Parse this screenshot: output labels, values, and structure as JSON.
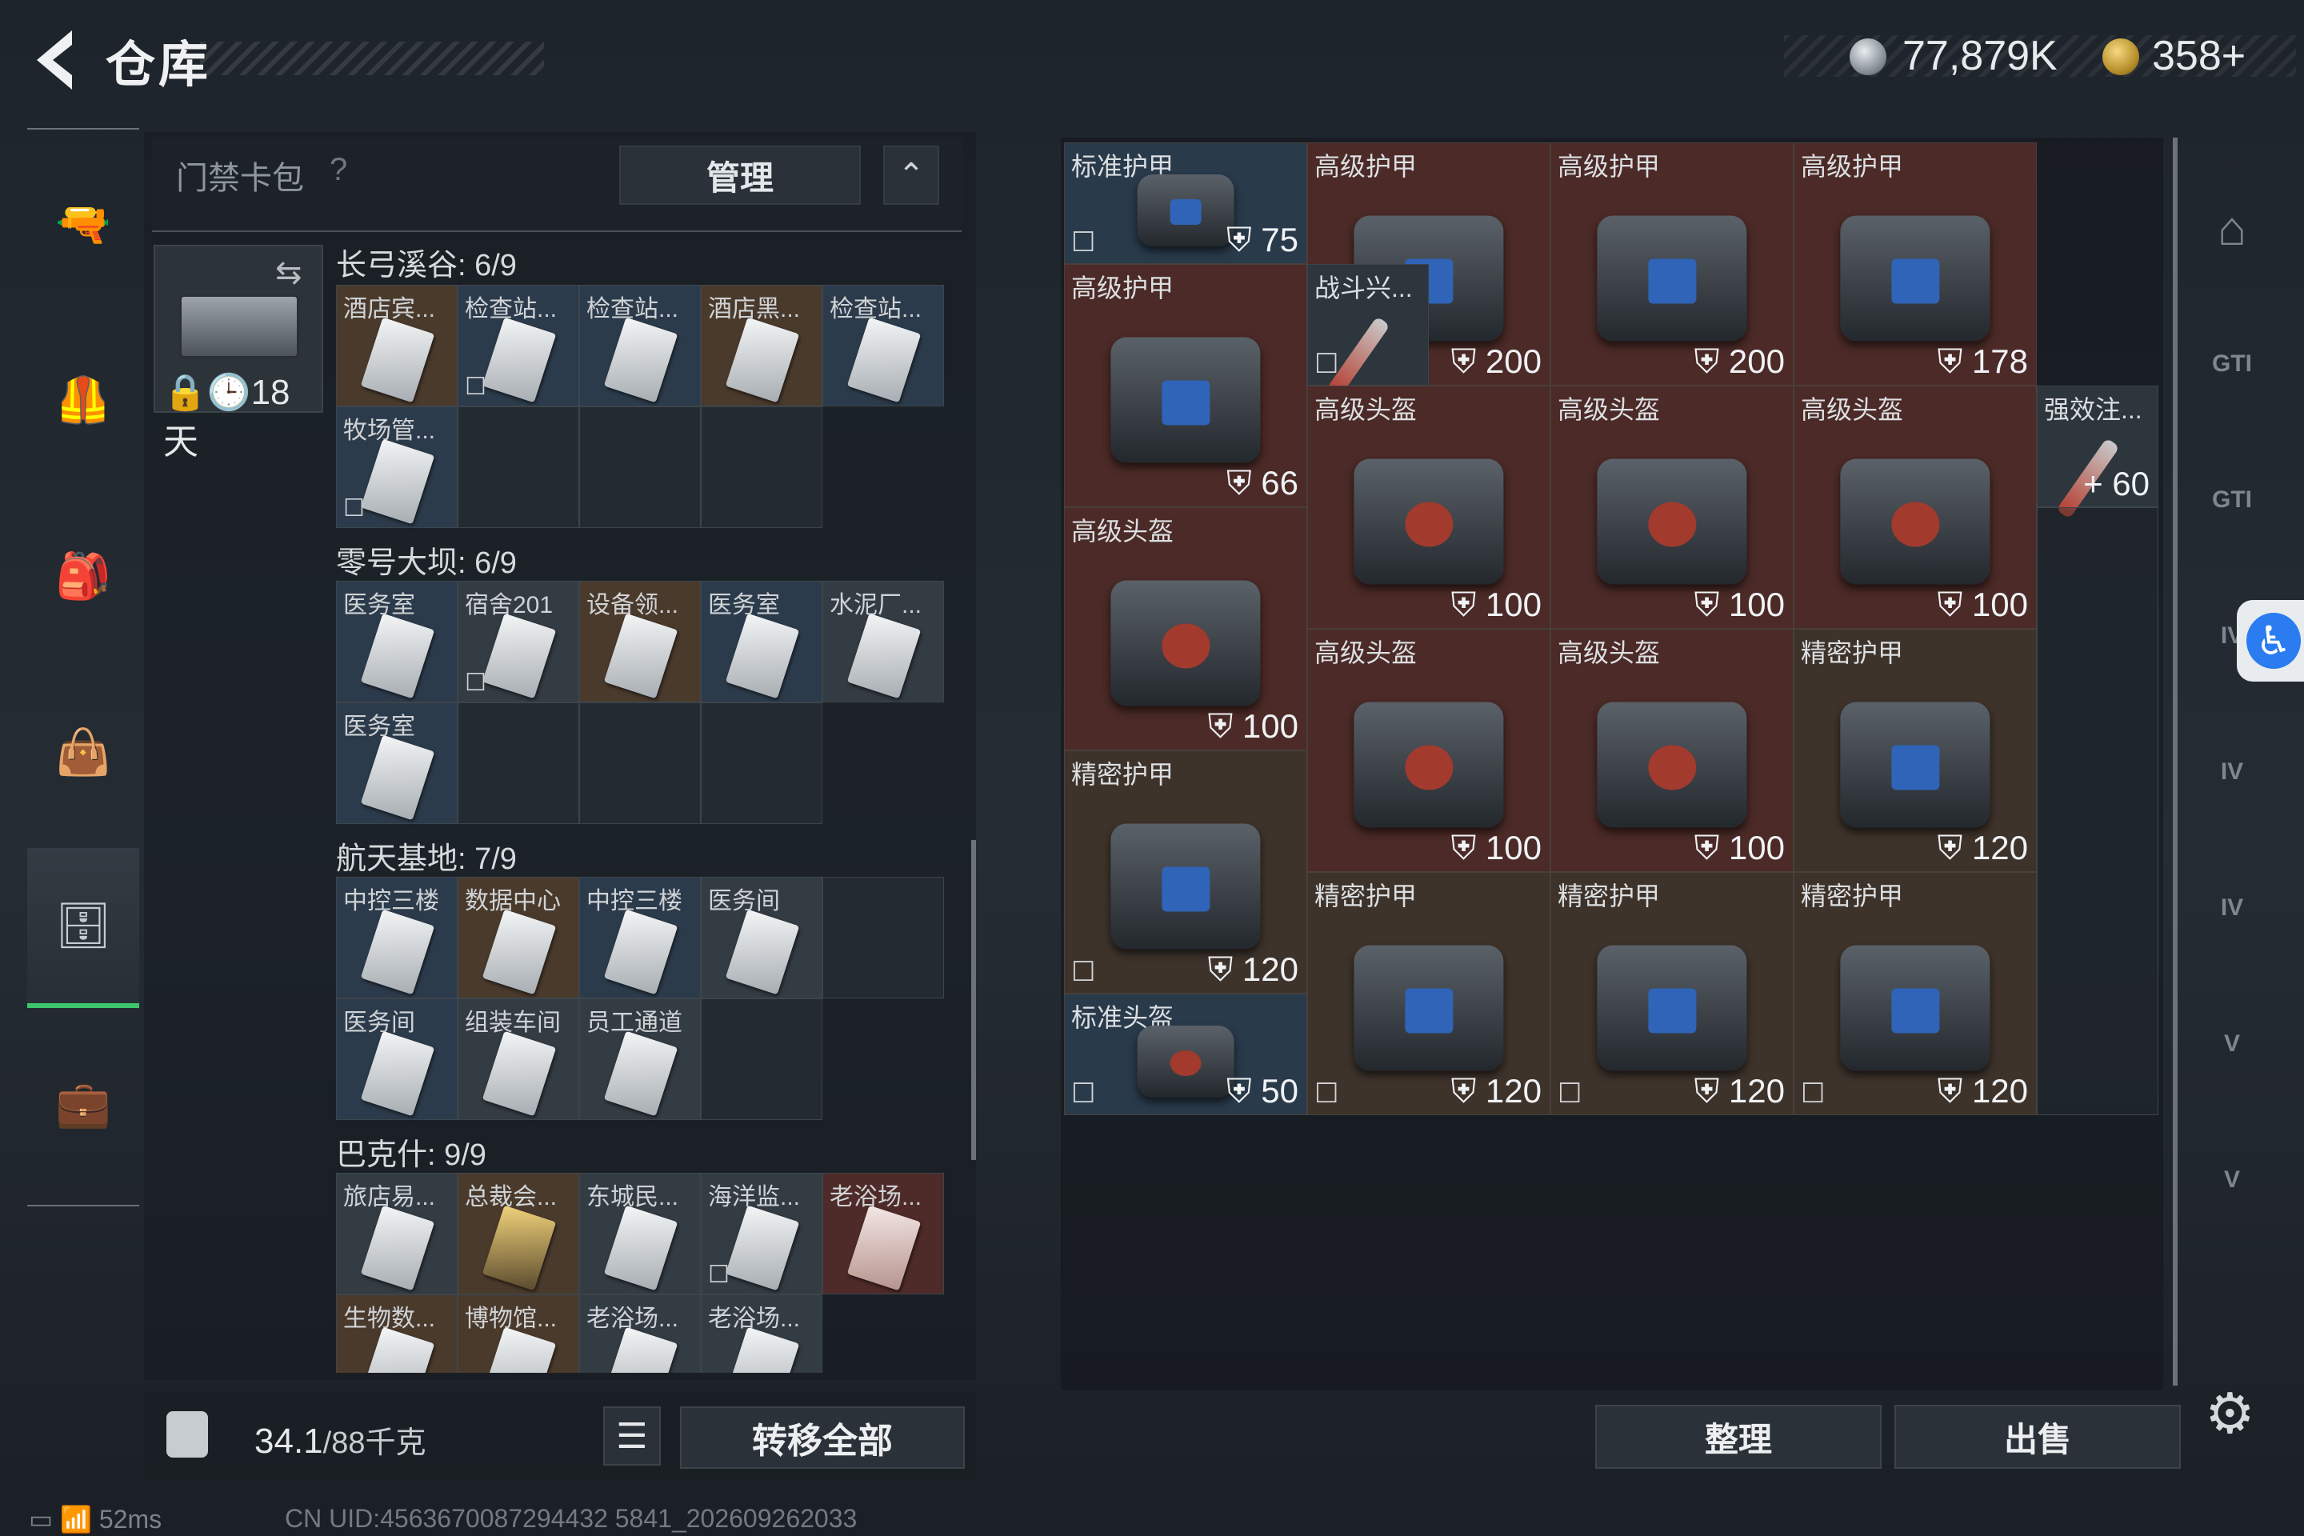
{
  "header": {
    "title": "仓库",
    "currency_silver": "77,879K",
    "currency_gold": "358+"
  },
  "card_pack": {
    "title": "门禁卡包",
    "help": "?",
    "manage_label": "管理",
    "collapse_icon": "chevron-up-icon",
    "days": "18天"
  },
  "sections": [
    {
      "title": "长弓溪谷: 6/9",
      "cards": [
        "酒店宾...",
        "检查站...",
        "检查站...",
        "酒店黑...",
        "检查站...",
        "牧场管..."
      ]
    },
    {
      "title": "零号大坝: 6/9",
      "cards": [
        "医务室",
        "宿舍201",
        "设备领...",
        "医务室",
        "水泥厂...",
        "医务室"
      ]
    },
    {
      "title": "航天基地: 7/9",
      "cards": [
        "中控三楼",
        "数据中心",
        "中控三楼",
        "医务间",
        "医务间",
        "组装车间",
        "员工通道"
      ]
    },
    {
      "title": "巴克什: 9/9",
      "cards": [
        "旅店易...",
        "总裁会...",
        "东城民...",
        "海洋监...",
        "老浴场...",
        "生物数...",
        "博物馆...",
        "老浴场...",
        "老浴场..."
      ]
    }
  ],
  "footer": {
    "weight": "34.1",
    "weight_unit": "/88千克",
    "transfer_all": "转移全部",
    "sort": "整理",
    "sell": "出售"
  },
  "items": [
    {
      "label": "标准护甲",
      "value": "75"
    },
    {
      "label": "高级护甲",
      "value": "200"
    },
    {
      "label": "高级护甲",
      "value": "200"
    },
    {
      "label": "高级护甲",
      "value": "178"
    },
    {
      "label": "高级护甲",
      "value": "66"
    },
    {
      "label": "战斗兴...",
      "value": ""
    },
    {
      "label": "高级头盔",
      "value": "100"
    },
    {
      "label": "高级头盔",
      "value": "100"
    },
    {
      "label": "高级头盔",
      "value": "100"
    },
    {
      "label": "强效注...",
      "value": "+ 60"
    },
    {
      "label": "高级头盔",
      "value": "100"
    },
    {
      "label": "高级头盔",
      "value": "100"
    },
    {
      "label": "高级头盔",
      "value": "100"
    },
    {
      "label": "精密护甲",
      "value": "120"
    },
    {
      "label": "精密护甲",
      "value": "120"
    },
    {
      "label": "精密护甲",
      "value": "120"
    },
    {
      "label": "精密护甲",
      "value": "120"
    },
    {
      "label": "精密护甲",
      "value": "120"
    },
    {
      "label": "标准头盔",
      "value": "50"
    }
  ],
  "right_nav": [
    "GTI",
    "GTI",
    "IV",
    "IV",
    "IV",
    "V",
    "V"
  ],
  "status": {
    "ping": "52ms",
    "uid": "CN UID:4563670087294432 5841_202609262033"
  }
}
